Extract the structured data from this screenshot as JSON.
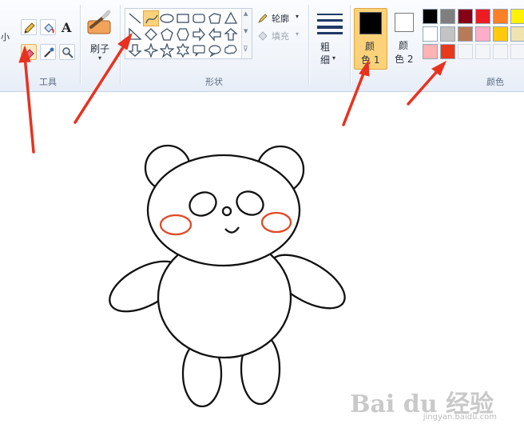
{
  "ribbon": {
    "size_label_fragment": "小",
    "tools_label": "工具",
    "brushes_label": "刷子",
    "shapes_label": "形状",
    "outline_label": "轮廓",
    "fill_label": "填充",
    "thickness_label_line1": "粗",
    "thickness_label_line2": "细",
    "color1_label_line1": "颜",
    "color1_label_line2": "色 1",
    "color2_label_line1": "颜",
    "color2_label_line2": "色 2",
    "colors_label": "颜色",
    "color1_value": "#000000",
    "color2_value": "#ffffff",
    "palette_row1": [
      "#000000",
      "#7f7f7f",
      "#880015",
      "#ed1c24",
      "#ff7f27",
      "#fff200"
    ],
    "palette_row2": [
      "#ffffff",
      "#c3c3c3",
      "#b97a57",
      "#ffaec9",
      "#ffc90e",
      "#efe4b0"
    ],
    "palette_row3": [
      "#ffb3b3",
      "#e8391d"
    ]
  },
  "colors": {
    "accent_selected": "#fbd27a",
    "annotation_arrow": "#e8321f",
    "cheek_stroke": "#e04a26"
  },
  "watermark": {
    "brand": "Bai du 经验",
    "url": "jingyan.baidu.com"
  }
}
